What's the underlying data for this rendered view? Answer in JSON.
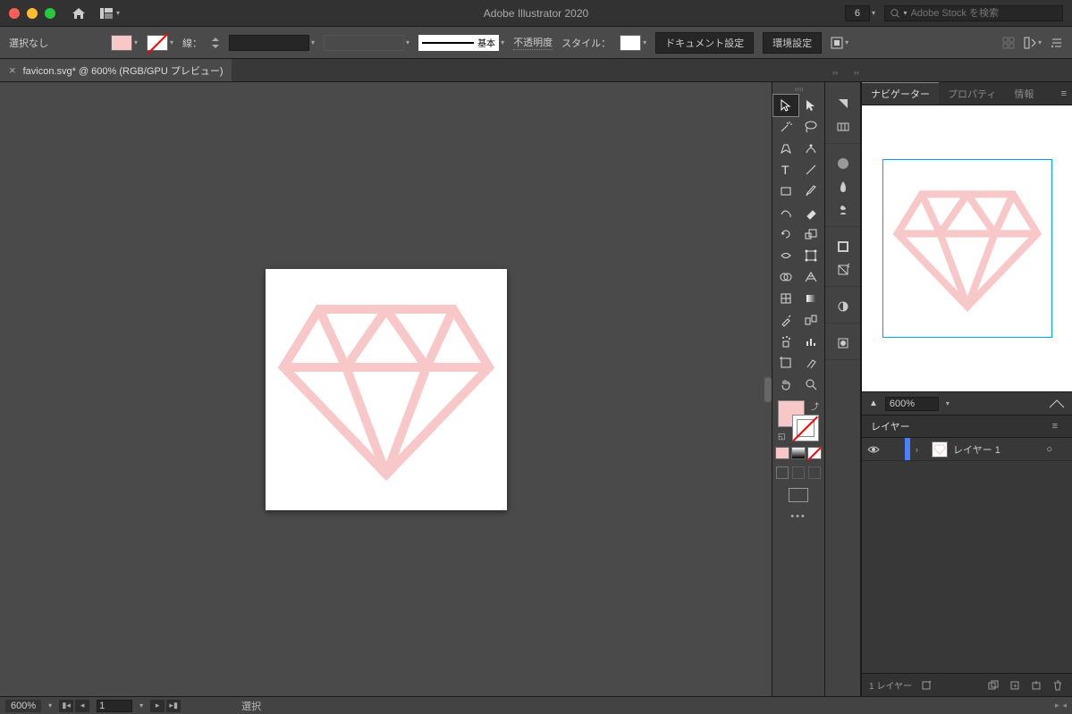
{
  "app": {
    "title": "Adobe Illustrator 2020",
    "doc_count": "6"
  },
  "search": {
    "placeholder": "Adobe Stock を検索"
  },
  "control": {
    "selection": "選択なし",
    "stroke_label": "線：",
    "style_basic": "基本",
    "opacity_label": "不透明度",
    "style_label": "スタイル：",
    "doc_setup": "ドキュメント設定",
    "env_setup": "環境設定"
  },
  "tab": {
    "name": "favicon.svg* @ 600% (RGB/GPU プレビュー)"
  },
  "panels": {
    "navigator": "ナビゲーター",
    "properties": "プロパティ",
    "info": "情報",
    "zoom": "600%",
    "layers": "レイヤー"
  },
  "layer": {
    "name": "レイヤー 1",
    "target": "○"
  },
  "layers_footer": {
    "count": "1 レイヤー"
  },
  "status": {
    "zoom": "600%",
    "page": "1",
    "mode": "選択"
  },
  "colors": {
    "fill": "#F8C8C8"
  }
}
